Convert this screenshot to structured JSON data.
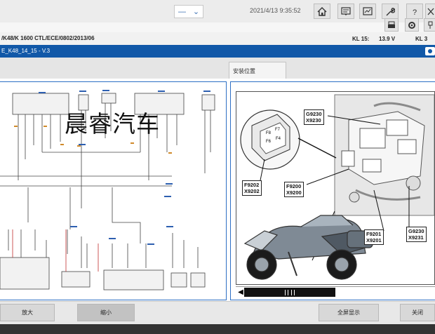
{
  "header": {
    "dropdown_value": "—",
    "datetime": "2021/4/13 9:35:52",
    "toolbar_icons": [
      "home-icon",
      "vehicle-data-icon",
      "measuring-icon",
      "wrench-icon",
      "help-icon",
      "exit-icon"
    ],
    "secondary_icons": [
      "print-icon",
      "settings-icon",
      "pin-icon"
    ]
  },
  "vehicle": {
    "info": "/K48/K 1600 CTL/ECE/0802/2013/06",
    "kl15_label": "KL 15:",
    "kl15_value": "13.9 V",
    "kl30_label": "KL 3"
  },
  "document": {
    "code": "E_K48_14_15 - V.3"
  },
  "tabs": {
    "install_location": "安装位置"
  },
  "watermark": "晨睿汽车",
  "diagram": {
    "labels": {
      "g9230_1": "G9230",
      "x9230": "X9230",
      "f9202": "F9202",
      "x9202": "X9202",
      "f9200": "F9200",
      "x9200": "X9200",
      "f9201": "F9201",
      "x9201": "X9201",
      "g9230_2": "G9230",
      "x9231": "X9231"
    },
    "relay_marks": [
      "F8",
      "F7",
      "F6",
      "F4"
    ]
  },
  "bottom": {
    "zoom_in": "放大",
    "zoom_out": "缩小",
    "fullscreen": "全屏显示",
    "close": "关闭"
  }
}
